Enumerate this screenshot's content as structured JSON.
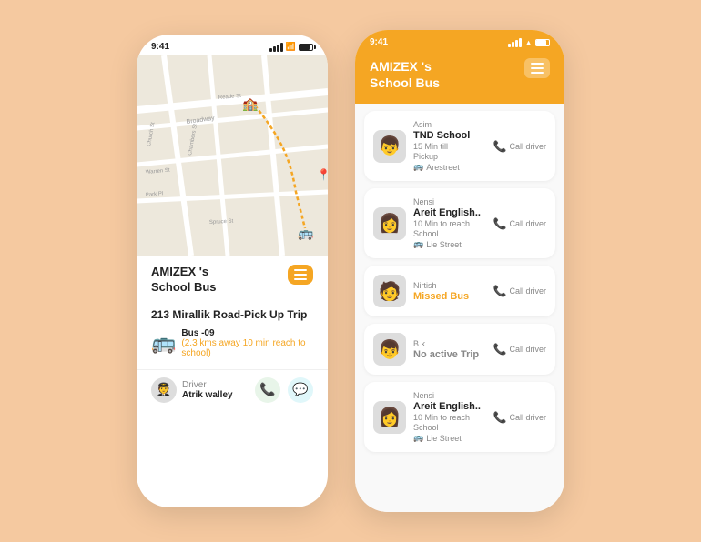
{
  "background": "#f5c9a0",
  "left_phone": {
    "status_bar": {
      "time": "9:41"
    },
    "header": {
      "title_line1": "AMIZEX 's",
      "title_line2": "School Bus",
      "menu_label": "menu"
    },
    "trip": {
      "title": "213 Mirallik Road-Pick Up Trip",
      "bus_number": "Bus -09",
      "bus_eta": "(2.3 kms away 10 min reach to school)"
    },
    "driver": {
      "label": "Driver",
      "name": "Atrik walley"
    }
  },
  "right_phone": {
    "status_bar": {
      "time": "9:41"
    },
    "header": {
      "title_line1": "AMIZEX 's",
      "title_line2": "School Bus",
      "menu_label": "menu"
    },
    "cards": [
      {
        "id": 1,
        "school": "TND School",
        "eta": "15 Min till",
        "action": "Pickup",
        "location": "Arestreet",
        "driver_name": "Asim",
        "call_label": "Call driver",
        "avatar": "👦",
        "status": "normal"
      },
      {
        "id": 2,
        "school": "Areit English..",
        "eta": "10 Min to reach",
        "action": "School",
        "location": "Lie Street",
        "driver_name": "Nensi",
        "call_label": "Call driver",
        "avatar": "👩",
        "status": "normal"
      },
      {
        "id": 3,
        "school": "Missed Bus",
        "eta": "",
        "action": "",
        "location": "",
        "driver_name": "Nirtish",
        "call_label": "Call driver",
        "avatar": "🧑",
        "status": "missed"
      },
      {
        "id": 4,
        "school": "No active Trip",
        "eta": "",
        "action": "",
        "location": "",
        "driver_name": "B.k",
        "call_label": "Call driver",
        "avatar": "👦",
        "status": "noactive"
      },
      {
        "id": 5,
        "school": "Areit English..",
        "eta": "10 Min to reach",
        "action": "School",
        "location": "Lie Street",
        "driver_name": "Nensi",
        "call_label": "Call driver",
        "avatar": "👩",
        "status": "normal"
      }
    ]
  }
}
